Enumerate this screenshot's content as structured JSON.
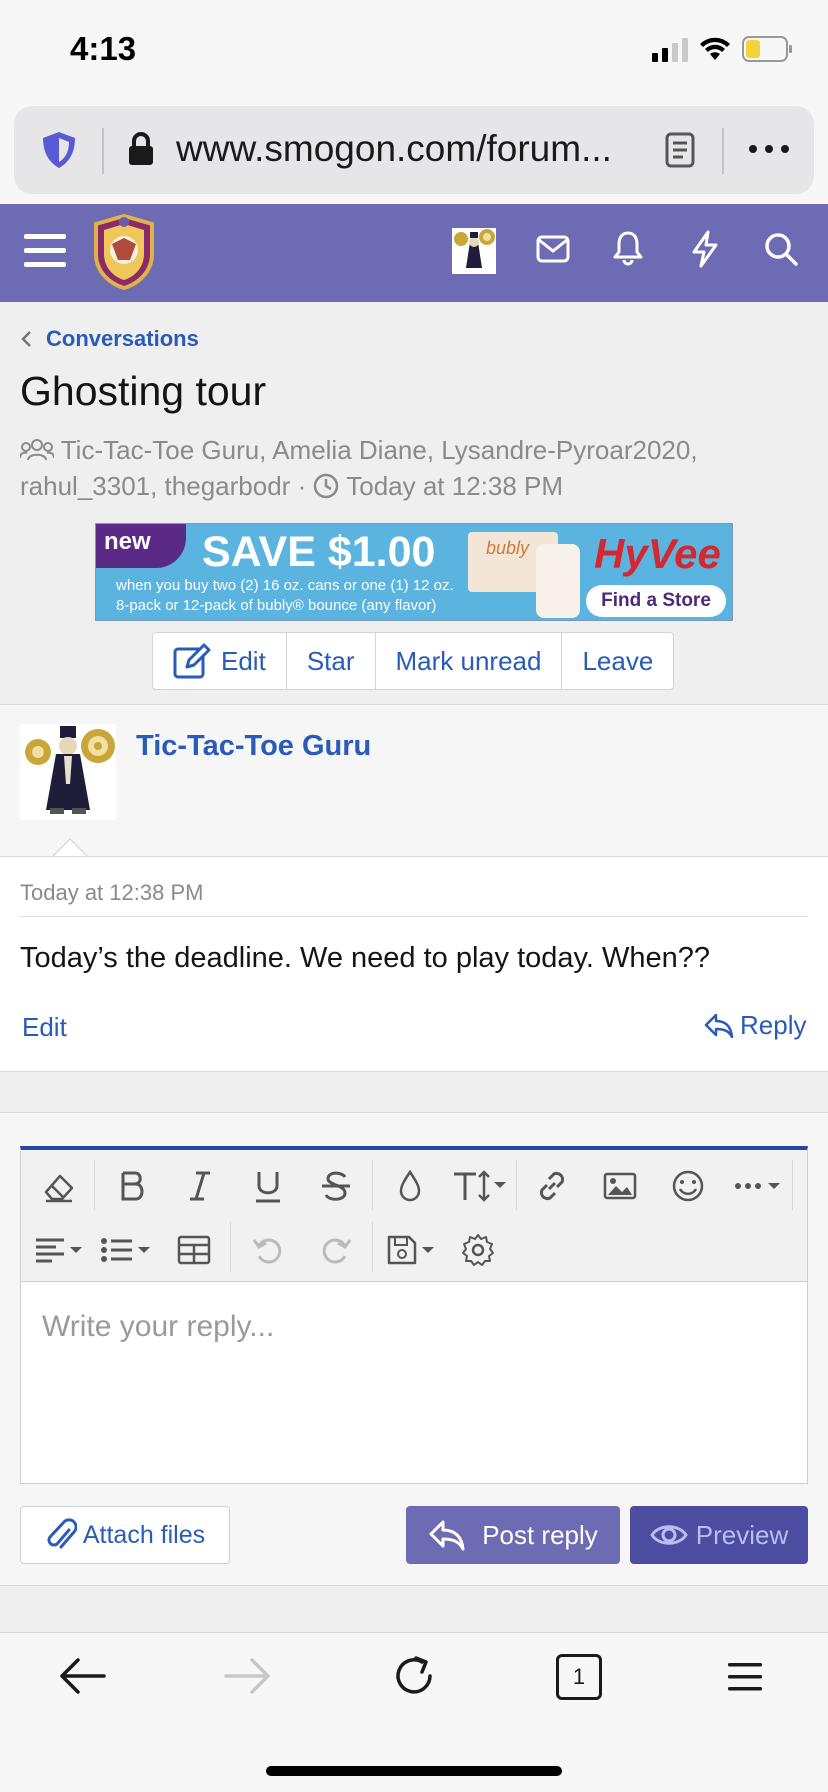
{
  "status_bar": {
    "time": "4:13"
  },
  "browser": {
    "url": "www.smogon.com/forum...",
    "tab_count": "1"
  },
  "breadcrumb": {
    "label": "Conversations"
  },
  "conversation": {
    "title": "Ghosting tour",
    "participants_line1": "Tic-Tac-Toe Guru, Amelia Diane, Lysandre-Pyroar2020,",
    "participants_line2": "rahul_3301, thegarbodr",
    "separator": "·",
    "timestamp": "Today at 12:38 PM"
  },
  "ad": {
    "badge": "new",
    "headline": "SAVE $1.00",
    "fine_print_line1": "when you buy two (2) 16 oz. cans or one (1) 12 oz.",
    "fine_print_line2": "8-pack or 12-pack of bubly® bounce (any flavor)",
    "product": "bubly",
    "brand": "HyVee",
    "cta": "Find a Store"
  },
  "actions": {
    "edit": "Edit",
    "star": "Star",
    "mark_unread": "Mark unread",
    "leave": "Leave"
  },
  "message": {
    "author": "Tic-Tac-Toe Guru",
    "time": "Today at 12:38 PM",
    "body": "Today’s the deadline. We need to play today. When??",
    "edit_label": "Edit",
    "reply_label": "Reply"
  },
  "editor": {
    "placeholder": "Write your reply..."
  },
  "footer_buttons": {
    "attach": "Attach files",
    "post": "Post reply",
    "preview": "Preview"
  },
  "colors": {
    "header": "#6c6bb4",
    "link": "#2a5bb8",
    "editor_accent": "#2746a8",
    "preview_button": "#4c4ca0"
  }
}
